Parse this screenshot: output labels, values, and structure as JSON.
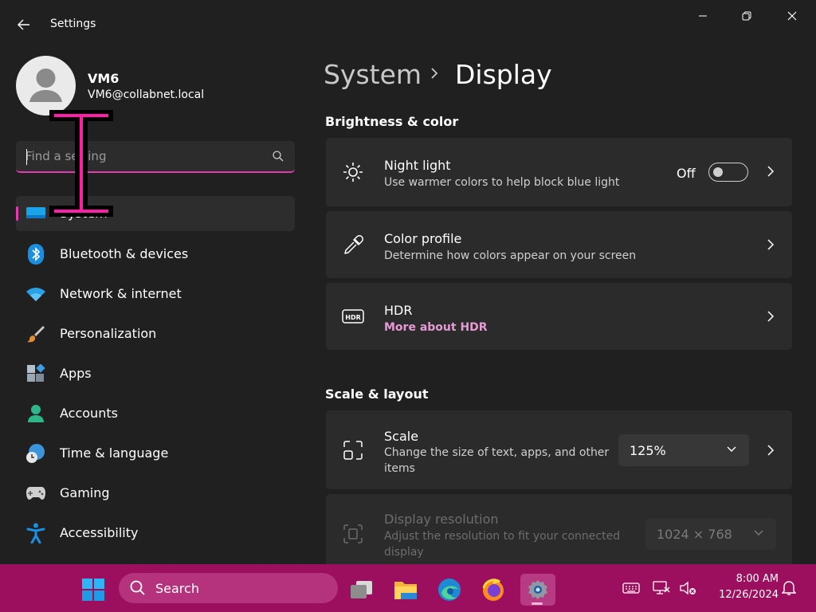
{
  "window": {
    "title": "Settings"
  },
  "profile": {
    "name": "VM6",
    "email": "VM6@collabnet.local"
  },
  "search": {
    "placeholder": "Find a setting",
    "value": ""
  },
  "nav": {
    "items": [
      {
        "label": "System",
        "icon": "system-icon",
        "selected": true
      },
      {
        "label": "Bluetooth & devices",
        "icon": "bluetooth-icon"
      },
      {
        "label": "Network & internet",
        "icon": "wifi-icon"
      },
      {
        "label": "Personalization",
        "icon": "brush-icon"
      },
      {
        "label": "Apps",
        "icon": "apps-icon"
      },
      {
        "label": "Accounts",
        "icon": "accounts-icon"
      },
      {
        "label": "Time & language",
        "icon": "time-language-icon"
      },
      {
        "label": "Gaming",
        "icon": "gamepad-icon"
      },
      {
        "label": "Accessibility",
        "icon": "accessibility-icon"
      }
    ]
  },
  "breadcrumb": {
    "parent": "System",
    "current": "Display"
  },
  "sections": {
    "brightness": {
      "title": "Brightness & color",
      "night_light": {
        "title": "Night light",
        "desc": "Use warmer colors to help block blue light",
        "state_label": "Off",
        "on": false
      },
      "color_profile": {
        "title": "Color profile",
        "desc": "Determine how colors appear on your screen"
      },
      "hdr": {
        "title": "HDR",
        "link": "More about HDR"
      }
    },
    "scale_layout": {
      "title": "Scale & layout",
      "scale": {
        "title": "Scale",
        "desc": "Change the size of text, apps, and other items",
        "value": "125%"
      },
      "resolution": {
        "title": "Display resolution",
        "desc": "Adjust the resolution to fit your connected display",
        "value": "1024 × 768"
      }
    }
  },
  "taskbar": {
    "search_label": "Search",
    "clock_time": "8:00 AM",
    "clock_date": "12/26/2024",
    "apps": [
      "start-icon",
      "task-view-icon",
      "file-explorer-icon",
      "edge-icon",
      "firefox-icon",
      "settings-icon"
    ]
  },
  "colors": {
    "accent": "#e33bb1",
    "taskbar": "#9c0e5e",
    "background": "#202020",
    "card": "#2b2b2b"
  }
}
